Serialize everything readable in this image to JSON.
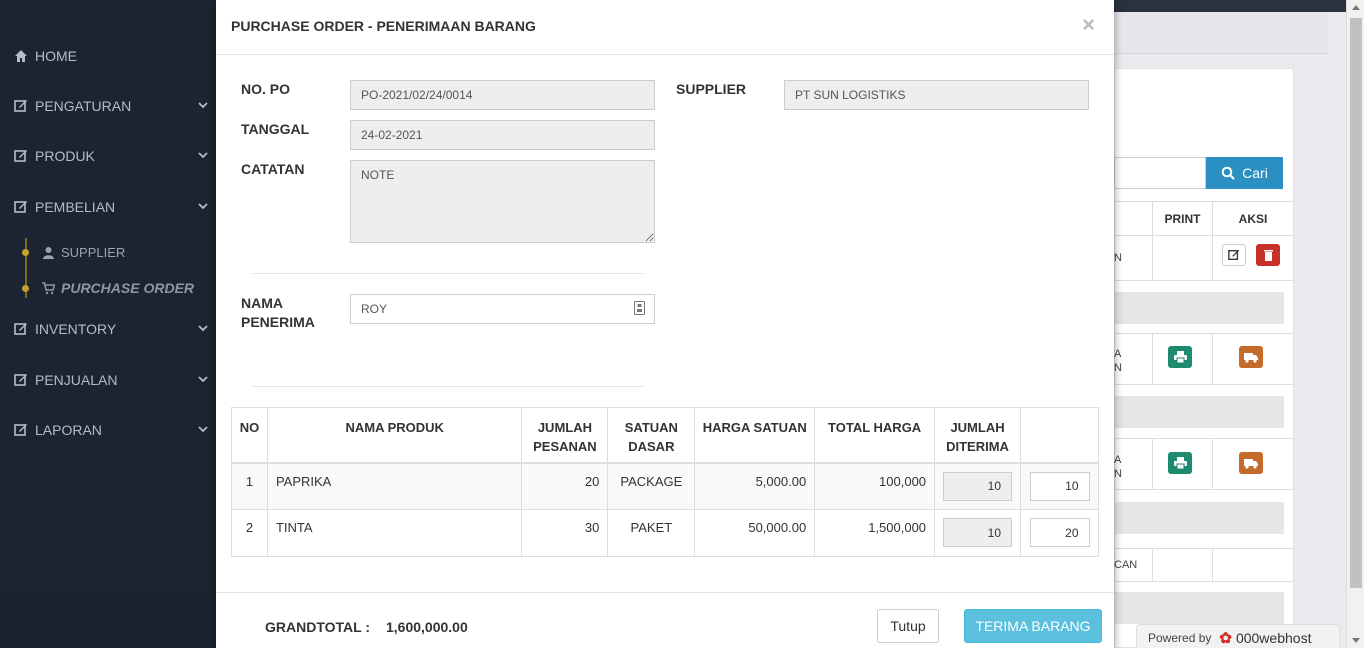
{
  "sidebar": {
    "items": [
      {
        "label": "HOME"
      },
      {
        "label": "PENGATURAN"
      },
      {
        "label": "PRODUK"
      },
      {
        "label": "PEMBELIAN"
      },
      {
        "label": "INVENTORY"
      },
      {
        "label": "PENJUALAN"
      },
      {
        "label": "LAPORAN"
      }
    ],
    "sub_items": [
      {
        "label": "SUPPLIER"
      },
      {
        "label": "PURCHASE ORDER"
      }
    ]
  },
  "background": {
    "search_button": "Cari",
    "col_print": "PRINT",
    "col_aksi": "AKSI",
    "row_fragments": [
      "N",
      "A",
      "N",
      "A",
      "N",
      "CAN"
    ]
  },
  "modal": {
    "title": "PURCHASE ORDER - PENERIMAAN BARANG",
    "close": "×",
    "labels": {
      "no_po": "NO. PO",
      "supplier": "SUPPLIER",
      "tanggal": "TANGGAL",
      "catatan": "CATATAN",
      "nama_penerima_1": "NAMA",
      "nama_penerima_2": "PENERIMA"
    },
    "values": {
      "no_po": "PO-2021/02/24/0014",
      "supplier": "PT SUN LOGISTIKS",
      "tanggal": "24-02-2021",
      "catatan": "NOTE",
      "nama_penerima": "ROY"
    },
    "table": {
      "headers": {
        "no": "NO",
        "nama_produk": "NAMA PRODUK",
        "jumlah_pesanan_1": "JUMLAH",
        "jumlah_pesanan_2": "PESANAN",
        "satuan_dasar_1": "SATUAN",
        "satuan_dasar_2": "DASAR",
        "harga_satuan": "HARGA SATUAN",
        "total_harga": "TOTAL HARGA",
        "jumlah_diterima_1": "JUMLAH",
        "jumlah_diterima_2": "DITERIMA"
      },
      "rows": [
        {
          "no": "1",
          "nama": "PAPRIKA",
          "jumlah": "20",
          "satuan": "PACKAGE",
          "harga": "5,000.00",
          "total": "100,000",
          "diterima": "10",
          "input": "10"
        },
        {
          "no": "2",
          "nama": "TINTA",
          "jumlah": "30",
          "satuan": "PAKET",
          "harga": "50,000.00",
          "total": "1,500,000",
          "diterima": "10",
          "input": "20"
        }
      ]
    },
    "footer": {
      "grandtotal_label": "GRANDTOTAL :",
      "grandtotal_value": "1,600,000.00",
      "tutup": "Tutup",
      "terima": "TERIMA BARANG"
    }
  },
  "webhost": {
    "powered_by": "Powered by",
    "brand": "000webhost"
  },
  "colors": {
    "sidebar_bg": "#1c2431",
    "accent_info": "#5bc0de",
    "cari_blue": "#2b8fc2",
    "print_green": "#1e8a6e",
    "delete_red": "#c9302c",
    "truck_orange": "#c46a2a"
  }
}
